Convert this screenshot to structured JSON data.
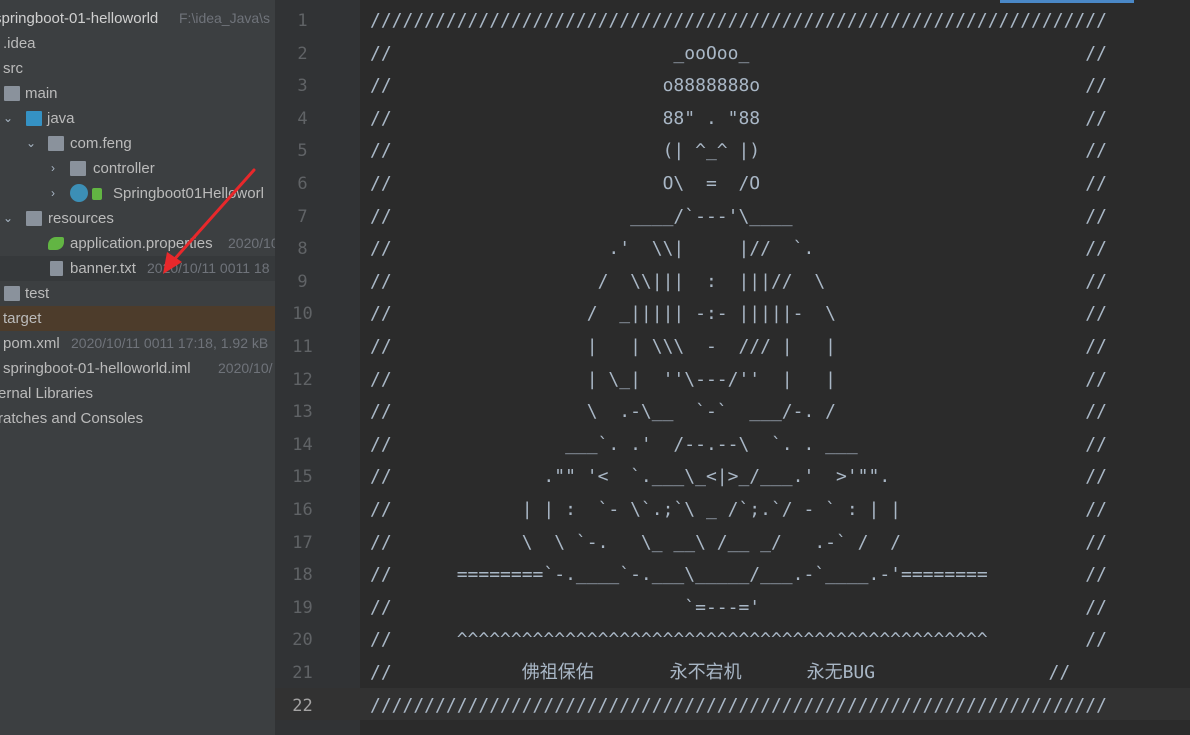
{
  "project_panel": {
    "root": {
      "name": "springboot-01-helloworld",
      "path": "F:\\idea_Java\\s"
    },
    "items": [
      {
        "label": ".idea"
      },
      {
        "label": "src"
      },
      {
        "label": "main"
      },
      {
        "label": "java"
      },
      {
        "label": "com.feng"
      },
      {
        "label": "controller"
      },
      {
        "label": "Springboot01Helloworl"
      },
      {
        "label": "resources"
      },
      {
        "label": "application.properties",
        "meta": "2020/10"
      },
      {
        "label": "banner.txt",
        "meta": "2020/10/11 0011 18"
      },
      {
        "label": "test"
      },
      {
        "label": "target"
      },
      {
        "label": "pom.xml",
        "meta": "2020/10/11 0011 17:18, 1.92 kB"
      },
      {
        "label": "springboot-01-helloworld.iml",
        "meta": "2020/10/"
      },
      {
        "label": "ernal Libraries"
      },
      {
        "label": "ratches and Consoles"
      }
    ]
  },
  "editor": {
    "lines": [
      "////////////////////////////////////////////////////////////////////",
      "//                          _ooOoo_                               //",
      "//                         o8888888o                              //",
      "//                         88\" . \"88                              //",
      "//                         (| ^_^ |)                              //",
      "//                         O\\  =  /O                              //",
      "//                      ____/`---'\\____                           //",
      "//                    .'  \\\\|     |//  `.                         //",
      "//                   /  \\\\|||  :  |||//  \\                        //",
      "//                  /  _||||| -:- |||||-  \\                       //",
      "//                  |   | \\\\\\  -  /// |   |                       //",
      "//                  | \\_|  ''\\---/''  |   |                       //",
      "//                  \\  .-\\__  `-`  ___/-. /                       //",
      "//                ___`. .'  /--.--\\  `. . ___                     //",
      "//              .\"\" '<  `.___\\_<|>_/___.'  >'\"\".                  //",
      "//            | | :  `- \\`.;`\\ _ /`;.`/ - ` : | |                 //",
      "//            \\  \\ `-.   \\_ __\\ /__ _/   .-` /  /                 //",
      "//      ========`-.____`-.___\\_____/___.-`____.-'========         //",
      "//                           `=---='                              //",
      "//      ^^^^^^^^^^^^^^^^^^^^^^^^^^^^^^^^^^^^^^^^^^^^^^^^^         //",
      "//            佛祖保佑       永不宕机      永无BUG                //",
      "////////////////////////////////////////////////////////////////////"
    ],
    "line_numbers": [
      "1",
      "2",
      "3",
      "4",
      "5",
      "6",
      "7",
      "8",
      "9",
      "10",
      "11",
      "12",
      "13",
      "14",
      "15",
      "16",
      "17",
      "18",
      "19",
      "20",
      "21",
      "22"
    ],
    "current_line": 22
  },
  "colors": {
    "panel_bg": "#3c3f41",
    "editor_bg": "#2b2b2b",
    "gutter_bg": "#313335",
    "text": "#a9b7c6",
    "annotation_arrow": "#e8282b"
  }
}
